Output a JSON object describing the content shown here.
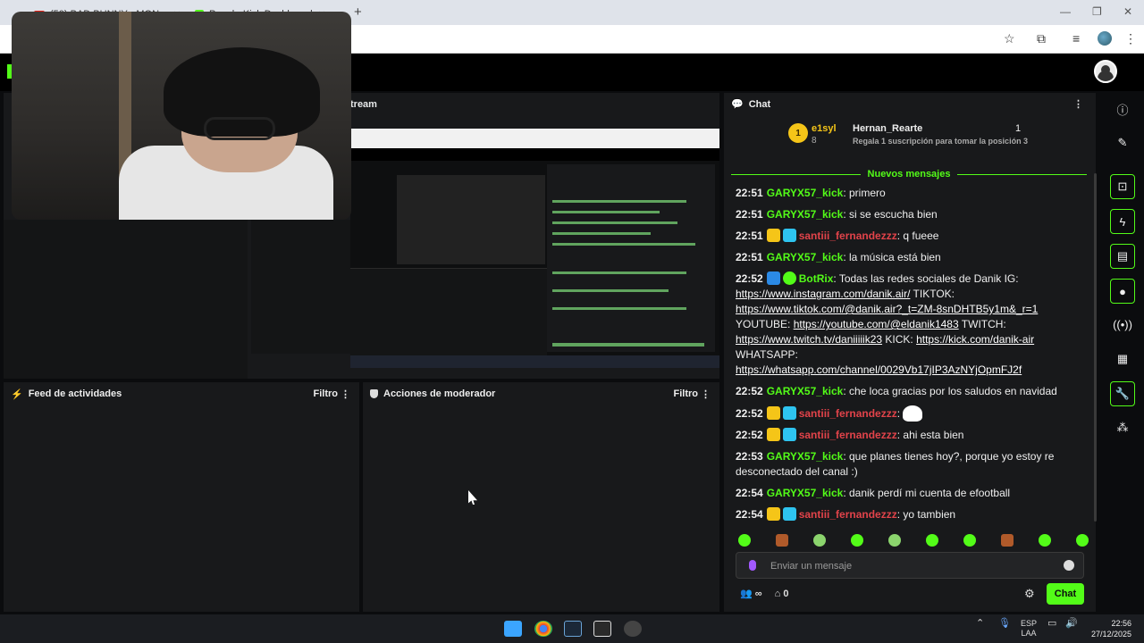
{
  "browser": {
    "tabs": [
      {
        "label": "(50) BAD BUNNY - MON..."
      },
      {
        "label": "Panel - Kick Dashboard"
      }
    ],
    "new_tab": "+"
  },
  "panels": {
    "stream_title": "tream",
    "feed": {
      "title": "Feed de actividades",
      "filter": "Filtro"
    },
    "mod": {
      "title": "Acciones de moderador",
      "filter": "Filtro"
    }
  },
  "chat": {
    "title": "Chat",
    "leaderboard": {
      "rank": "1",
      "name1": "e1syl",
      "count1": "8",
      "name2": "Hernan_Rearte",
      "count2": "1",
      "subtitle": "Regala 1 suscripción para tomar la posición 3"
    },
    "new_messages": "Nuevos mensajes",
    "messages": [
      {
        "time": "22:51",
        "user": "GARYX57_kick",
        "text": "primero"
      },
      {
        "time": "22:51",
        "user": "GARYX57_kick",
        "text": "si se escucha bien"
      },
      {
        "time": "22:51",
        "user": "santiii_fernandezzz",
        "text": "q fueee"
      },
      {
        "time": "22:51",
        "user": "GARYX57_kick",
        "text": "la música está bien"
      },
      {
        "time": "22:52",
        "user": "BotRix",
        "text_parts": [
          "Todas las redes sociales de Danik IG:",
          "TIKTOK:",
          "YOUTUBE:",
          "TWITCH:",
          "KICK:",
          "WHATSAPP:"
        ],
        "links": [
          "https://www.instagram.com/danik.air/",
          "https://www.tiktok.com/@danik.air?_t=ZM-8snDHTB5y1m&_r=1",
          "https://youtube.com/@eldanik1483",
          "https://www.twitch.tv/daniiiiik23",
          "https://kick.com/danik-air",
          "https://whatsapp.com/channel/0029Vb17jIP3AzNYjOpmFJ2f"
        ]
      },
      {
        "time": "22:52",
        "user": "GARYX57_kick",
        "text": "che loca gracias por los saludos en navidad"
      },
      {
        "time": "22:52",
        "user": "santiii_fernandezzz",
        "text": ":"
      },
      {
        "time": "22:52",
        "user": "santiii_fernandezzz",
        "text": "ahi esta bien"
      },
      {
        "time": "22:53",
        "user": "GARYX57_kick",
        "text": "que planes tienes hoy?, porque yo estoy re desconectado del canal :)"
      },
      {
        "time": "22:54",
        "user": "GARYX57_kick",
        "text": "danik perdí mi cuenta de efootball"
      },
      {
        "time": "22:54",
        "user": "santiii_fernandezzz",
        "text": "yo tambien"
      }
    ],
    "input_placeholder": "Enviar un mensaje",
    "footer": {
      "infinity": "∞",
      "count": "0"
    },
    "send_label": "Chat"
  },
  "taskbar": {
    "lang1": "ESP",
    "lang2": "LAA",
    "time": "22:56",
    "date": "27/12/2025"
  },
  "colors": {
    "accent": "#53fc18",
    "bg": "#0b0c0e",
    "panel": "#18191b",
    "red_user": "#e2434a"
  }
}
